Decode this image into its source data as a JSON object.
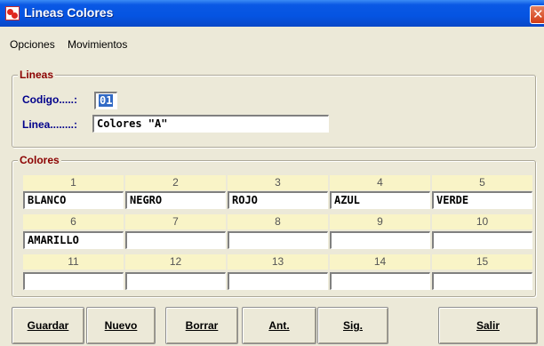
{
  "window": {
    "title": "Lineas Colores",
    "close_glyph": "✕",
    "title_icon": "app-icon"
  },
  "menu": [
    {
      "label": "Opciones"
    },
    {
      "label": "Movimientos"
    }
  ],
  "lineas": {
    "legend": "Lineas",
    "codigo_label": "Codigo.....:",
    "codigo_value": "01",
    "linea_label": "Linea........:",
    "linea_value": "Colores \"A\""
  },
  "colores": {
    "legend": "Colores",
    "headers": [
      "1",
      "2",
      "3",
      "4",
      "5",
      "6",
      "7",
      "8",
      "9",
      "10",
      "11",
      "12",
      "13",
      "14",
      "15"
    ],
    "values": [
      "BLANCO",
      "NEGRO",
      "ROJO",
      "AZUL",
      "VERDE",
      "AMARILLO",
      "",
      "",
      "",
      "",
      "",
      "",
      "",
      "",
      ""
    ]
  },
  "buttons": [
    {
      "label": "Guardar"
    },
    {
      "label": "Nuevo"
    },
    {
      "label": "Borrar"
    },
    {
      "label": "Ant."
    },
    {
      "label": "Sig."
    },
    {
      "label": "Salir"
    }
  ]
}
